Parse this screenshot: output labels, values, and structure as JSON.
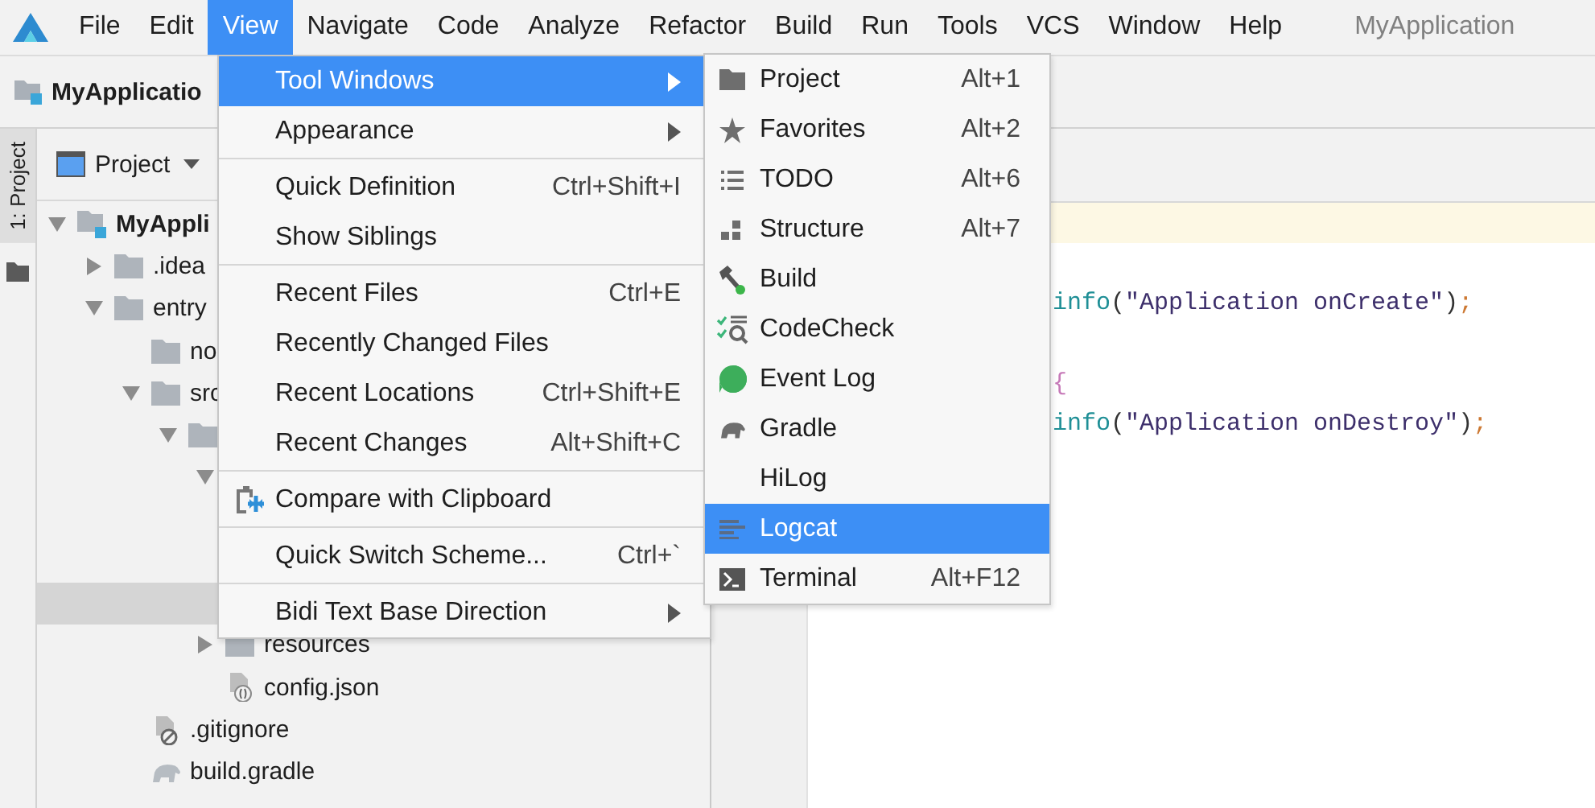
{
  "app_title": "MyApplication",
  "menubar": {
    "items": [
      {
        "label": "File",
        "selected": false
      },
      {
        "label": "Edit",
        "selected": false
      },
      {
        "label": "View",
        "selected": true
      },
      {
        "label": "Navigate",
        "selected": false
      },
      {
        "label": "Code",
        "selected": false
      },
      {
        "label": "Analyze",
        "selected": false
      },
      {
        "label": "Refactor",
        "selected": false
      },
      {
        "label": "Build",
        "selected": false
      },
      {
        "label": "Run",
        "selected": false
      },
      {
        "label": "Tools",
        "selected": false
      },
      {
        "label": "VCS",
        "selected": false
      },
      {
        "label": "Window",
        "selected": false
      },
      {
        "label": "Help",
        "selected": false
      }
    ]
  },
  "breadcrumb": "MyApplicatio",
  "side_tab": {
    "label": "1: Project",
    "selected": true
  },
  "project_panel": {
    "view": "Project",
    "tree": [
      {
        "label": "MyAppli",
        "kind": "project",
        "expanded": true,
        "selected": false,
        "children": [
          {
            "label": ".idea",
            "kind": "folder",
            "expanded": false,
            "selected": false
          },
          {
            "label": "entry",
            "kind": "folder",
            "expanded": true,
            "selected": false,
            "children": [
              {
                "label": "no",
                "kind": "folder",
                "selected": false
              },
              {
                "label": "src",
                "kind": "folder",
                "expanded": true,
                "selected": false,
                "children": [
                  {
                    "kind": "folder",
                    "expanded": true,
                    "selected": false,
                    "children": [
                      {
                        "expanded": true,
                        "selected": false,
                        "children": [
                          {
                            "selected": true
                          }
                        ]
                      },
                      {
                        "label": "resources",
                        "kind": "folder",
                        "expanded": false,
                        "selected": false
                      },
                      {
                        "label": "config.json",
                        "kind": "json",
                        "selected": false
                      }
                    ]
                  }
                ]
              },
              {
                "label": ".gitignore",
                "kind": "ignore",
                "selected": false
              },
              {
                "label": "build.gradle",
                "kind": "gradle",
                "selected": false
              }
            ]
          }
        ]
      }
    ]
  },
  "editor": {
    "lines": [
      {
        "highlighted": true
      },
      {
        "highlighted": false
      },
      {
        "highlighted": false,
        "tokens": [
          {
            "kind": "fn",
            "text": "info"
          },
          {
            "kind": "punct",
            "text": "("
          },
          {
            "kind": "string",
            "text": "\"Application onCreate\""
          },
          {
            "kind": "punct",
            "text": ")"
          },
          {
            "kind": "semi",
            "text": ";"
          }
        ]
      },
      {
        "highlighted": false
      },
      {
        "highlighted": false,
        "tokens": [
          {
            "kind": "brace",
            "text": "{"
          }
        ]
      },
      {
        "highlighted": false,
        "tokens": [
          {
            "kind": "fn",
            "text": "info"
          },
          {
            "kind": "punct",
            "text": "("
          },
          {
            "kind": "string",
            "text": "\"Application onDestroy\""
          },
          {
            "kind": "punct",
            "text": ")"
          },
          {
            "kind": "semi",
            "text": ";"
          }
        ]
      }
    ]
  },
  "view_menu": {
    "items": [
      {
        "kind": "item",
        "label": "Tool Windows",
        "submenu": true,
        "selected": true
      },
      {
        "kind": "item",
        "label": "Appearance",
        "submenu": true,
        "selected": false
      },
      {
        "kind": "separator"
      },
      {
        "kind": "item",
        "label": "Quick Definition",
        "shortcut": "Ctrl+Shift+I",
        "submenu": false,
        "selected": false
      },
      {
        "kind": "item",
        "label": "Show Siblings",
        "submenu": false,
        "selected": false
      },
      {
        "kind": "separator"
      },
      {
        "kind": "item",
        "label": "Recent Files",
        "shortcut": "Ctrl+E",
        "submenu": false,
        "selected": false
      },
      {
        "kind": "item",
        "label": "Recently Changed Files",
        "submenu": false,
        "selected": false
      },
      {
        "kind": "item",
        "label": "Recent Locations",
        "shortcut": "Ctrl+Shift+E",
        "submenu": false,
        "selected": false
      },
      {
        "kind": "item",
        "label": "Recent Changes",
        "shortcut": "Alt+Shift+C",
        "submenu": false,
        "selected": false
      },
      {
        "kind": "separator"
      },
      {
        "kind": "icon-item",
        "label": "Compare with Clipboard",
        "submenu": false,
        "selected": false
      },
      {
        "kind": "separator"
      },
      {
        "kind": "item",
        "label": "Quick Switch Scheme...",
        "shortcut": "Ctrl+`",
        "submenu": false,
        "selected": false
      },
      {
        "kind": "separator"
      },
      {
        "kind": "item",
        "label": "Bidi Text Base Direction",
        "submenu": true,
        "selected": false
      }
    ]
  },
  "tool_windows_menu": {
    "items": [
      {
        "label": "Project",
        "shortcut": "Alt+1",
        "selected": false
      },
      {
        "label": "Favorites",
        "shortcut": "Alt+2",
        "selected": false
      },
      {
        "label": "TODO",
        "shortcut": "Alt+6",
        "selected": false
      },
      {
        "label": "Structure",
        "shortcut": "Alt+7",
        "selected": false
      },
      {
        "label": "Build",
        "selected": false
      },
      {
        "label": "CodeCheck",
        "selected": false
      },
      {
        "label": "Event Log",
        "selected": false
      },
      {
        "label": "Gradle",
        "selected": false
      },
      {
        "label": "HiLog",
        "selected": false
      },
      {
        "label": "Logcat",
        "selected": true
      },
      {
        "label": "Terminal",
        "shortcut": "Alt+F12",
        "selected": false
      }
    ]
  }
}
